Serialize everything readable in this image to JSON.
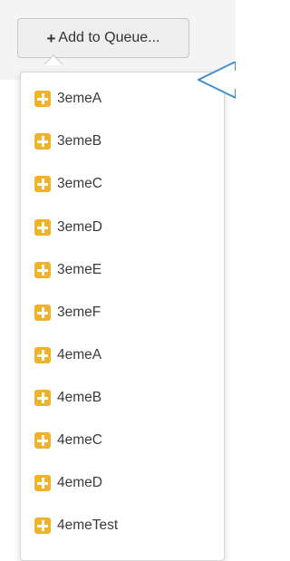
{
  "toolbar": {
    "add_to_queue_label": "Add to Queue..."
  },
  "dropdown": {
    "items": [
      {
        "label": "3emeA"
      },
      {
        "label": "3emeB"
      },
      {
        "label": "3emeC"
      },
      {
        "label": "3emeD"
      },
      {
        "label": "3emeE"
      },
      {
        "label": "3emeF"
      },
      {
        "label": "4emeA"
      },
      {
        "label": "4emeB"
      },
      {
        "label": "4emeC"
      },
      {
        "label": "4emeD"
      },
      {
        "label": "4emeTest"
      }
    ]
  },
  "icons": {
    "add_button_icon": "plus-icon",
    "item_icon": "plus-square-icon"
  },
  "colors": {
    "item_icon": "#f0b22a",
    "callout_arrow": "#3d8fd1",
    "button_bg": "#eeeeee"
  }
}
